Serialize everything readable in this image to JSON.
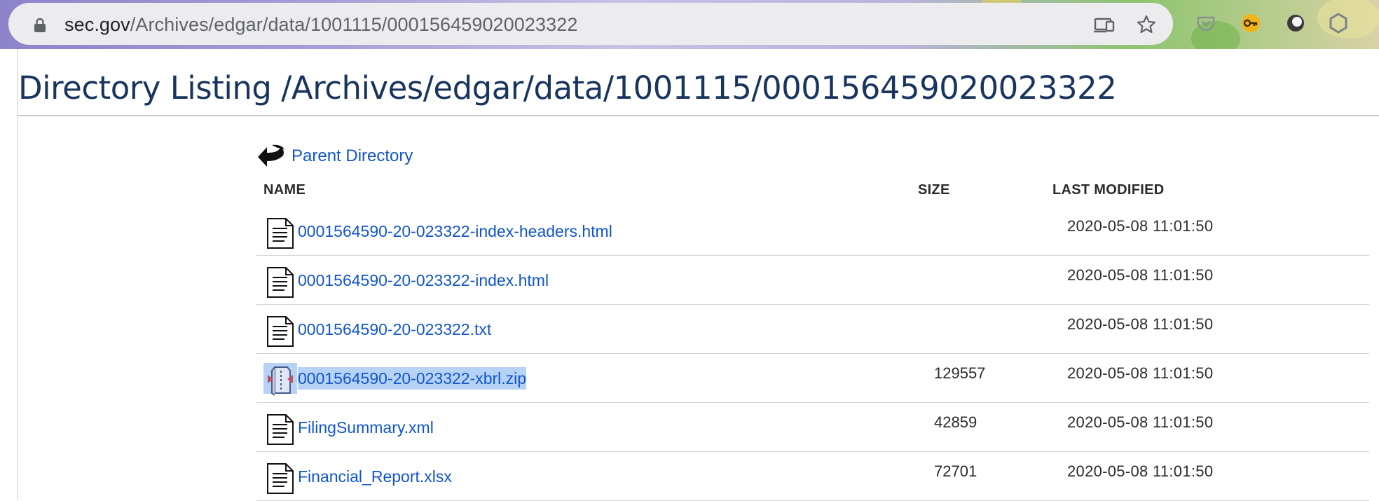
{
  "browser": {
    "url_host": "sec.gov",
    "url_path": "/Archives/edgar/data/1001115/000156459020023322",
    "icons": [
      "lock-icon",
      "cast-icon",
      "bookmark-star-icon",
      "pocket-icon",
      "key-extension-icon",
      "circle-extension-icon",
      "hexagon-extension-icon"
    ]
  },
  "page": {
    "title": "Directory Listing /Archives/edgar/data/1001115/000156459020023322",
    "parent_link": "Parent Directory",
    "columns": {
      "name": "NAME",
      "size": "SIZE",
      "modified": "LAST MODIFIED"
    },
    "rows": [
      {
        "name": "0001564590-20-023322-index-headers.html",
        "size": "",
        "modified": "2020-05-08 11:01:50",
        "icon": "document-icon"
      },
      {
        "name": "0001564590-20-023322-index.html",
        "size": "",
        "modified": "2020-05-08 11:01:50",
        "icon": "document-icon"
      },
      {
        "name": "0001564590-20-023322.txt",
        "size": "",
        "modified": "2020-05-08 11:01:50",
        "icon": "document-icon"
      },
      {
        "name": "0001564590-20-023322-xbrl.zip",
        "size": "129557",
        "modified": "2020-05-08 11:01:50",
        "icon": "archive-icon",
        "selected": true
      },
      {
        "name": "FilingSummary.xml",
        "size": "42859",
        "modified": "2020-05-08 11:01:50",
        "icon": "document-icon"
      },
      {
        "name": "Financial_Report.xlsx",
        "size": "72701",
        "modified": "2020-05-08 11:01:50",
        "icon": "document-icon"
      }
    ]
  },
  "colors": {
    "title": "#19355e",
    "link": "#1155cc",
    "selection": "#b6d2f5"
  }
}
